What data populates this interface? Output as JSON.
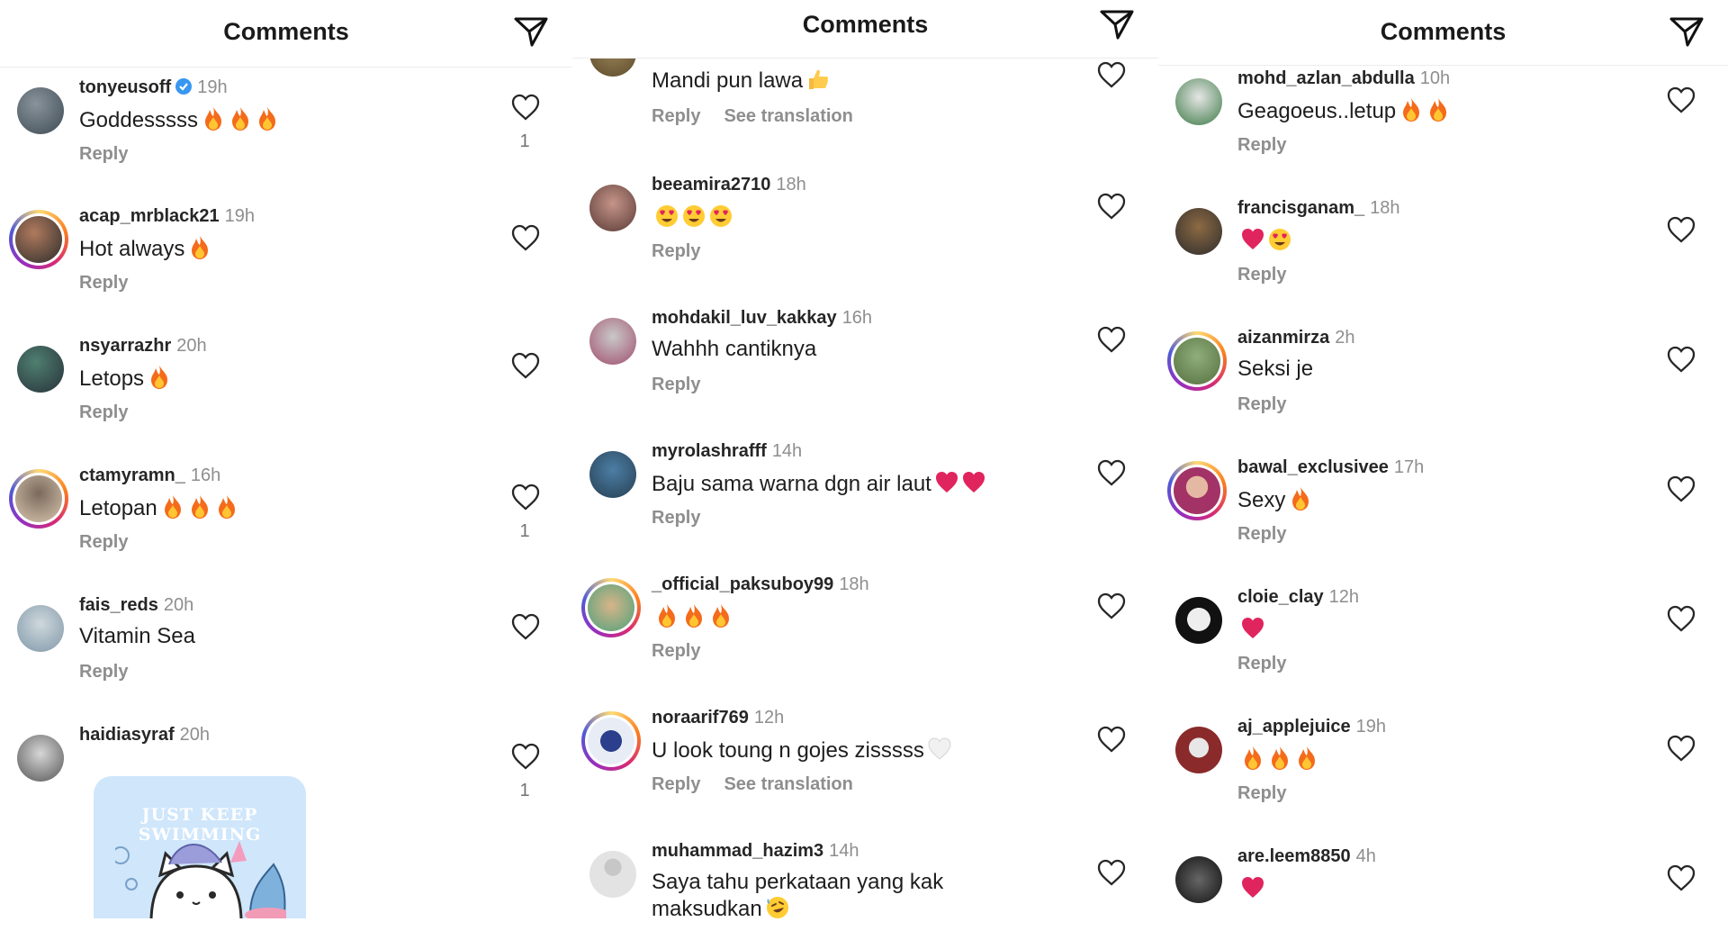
{
  "panels": [
    {
      "title": "Comments",
      "comments": [
        {
          "username": "tonyeusoff",
          "verified": true,
          "time": "19h",
          "text": "Goddesssss",
          "emojis": [
            "fire",
            "fire",
            "fire"
          ],
          "reply": "Reply",
          "likes": "1",
          "avatar_colors": [
            "#3f4b54",
            "#88939b"
          ]
        },
        {
          "username": "acap_mrblack21",
          "time": "19h",
          "text": "Hot always",
          "emojis": [
            "fire"
          ],
          "reply": "Reply",
          "story_ring": true,
          "avatar_colors": [
            "#b07a5d",
            "#2c2c2c"
          ]
        },
        {
          "username": "nsyarrazhr",
          "time": "20h",
          "text": "Letops",
          "emojis": [
            "fire"
          ],
          "reply": "Reply",
          "avatar_colors": [
            "#27313a",
            "#4f7f6f"
          ]
        },
        {
          "username": "ctamyramn_",
          "time": "16h",
          "text": "Letopan",
          "emojis": [
            "fire",
            "fire",
            "fire"
          ],
          "reply": "Reply",
          "likes": "1",
          "story_ring": true,
          "avatar_colors": [
            "#d8c5ae",
            "#7a6a5c"
          ]
        },
        {
          "username": "fais_reds",
          "time": "20h",
          "text": "Vitamin Sea",
          "emojis": [],
          "reply": "Reply",
          "avatar_colors": [
            "#7f97a8",
            "#cfd8dd"
          ]
        },
        {
          "username": "haidiasyraf",
          "time": "20h",
          "text": "",
          "emojis": [],
          "likes": "1",
          "avatar_colors": [
            "#d7d7d7",
            "#555555"
          ],
          "sticker_text": "JUST KEEP SWIMMING"
        }
      ]
    },
    {
      "title": "Comments",
      "comments": [
        {
          "username": "",
          "time": "",
          "text": "Mandi pun lawa",
          "emojis": [
            "thumbs-up"
          ],
          "reply": "Reply",
          "translation": "See translation",
          "avatar_colors": [
            "#9b8558",
            "#5c4a2c"
          ]
        },
        {
          "username": "beeamira2710",
          "time": "18h",
          "text": "",
          "emojis": [
            "heart-eyes",
            "heart-eyes",
            "heart-eyes"
          ],
          "reply": "Reply",
          "avatar_colors": [
            "#5a3b36",
            "#c59489"
          ]
        },
        {
          "username": "mohdakil_luv_kakkay",
          "time": "16h",
          "text": "Wahhh cantiknya",
          "emojis": [],
          "reply": "Reply",
          "avatar_colors": [
            "#c9c9c9",
            "#a14f6d"
          ]
        },
        {
          "username": "myrolashrafff",
          "time": "14h",
          "text": "Baju sama warna dgn air laut",
          "emojis": [
            "red-heart",
            "red-heart"
          ],
          "reply": "Reply",
          "avatar_colors": [
            "#4c7ea5",
            "#263f52"
          ]
        },
        {
          "username": "_official_paksuboy99",
          "time": "18h",
          "text": "",
          "emojis": [
            "fire",
            "fire",
            "fire"
          ],
          "reply": "Reply",
          "story_ring": true,
          "avatar_colors": [
            "#4da27a",
            "#d8b48a"
          ]
        },
        {
          "username": "noraarif769",
          "time": "12h",
          "text": "U look toung n gojes zisssss",
          "emojis": [
            "white-heart"
          ],
          "reply": "Reply",
          "translation": "See translation",
          "story_ring": true,
          "avatar_colors": [
            "#e8edf5",
            "#2b3f8d"
          ]
        },
        {
          "username": "muhammad_hazim3",
          "time": "14h",
          "text": "Saya tahu perkataan yang kak maksudkan",
          "emojis": [
            "rofl"
          ],
          "reply": "",
          "avatar_colors": [
            "#e3e3e3",
            "#c7c7c7"
          ]
        }
      ]
    },
    {
      "title": "Comments",
      "comments": [
        {
          "username": "mohd_azlan_abdulla",
          "time": "10h",
          "text": "Geagoeus..letup",
          "emojis": [
            "fire",
            "fire"
          ],
          "reply": "Reply",
          "avatar_colors": [
            "#3c7a46",
            "#e6e6e6"
          ]
        },
        {
          "username": "francisganam_",
          "time": "18h",
          "text": "",
          "emojis": [
            "red-heart",
            "heart-eyes"
          ],
          "reply": "Reply",
          "avatar_colors": [
            "#8d6a43",
            "#2d2d2d"
          ]
        },
        {
          "username": "aizanmirza",
          "time": "2h",
          "text": "Seksi je",
          "emojis": [],
          "reply": "Reply",
          "story_ring": true,
          "avatar_colors": [
            "#8fae7a",
            "#54703f"
          ]
        },
        {
          "username": "bawal_exclusivee",
          "time": "17h",
          "text": "Sexy",
          "emojis": [
            "fire"
          ],
          "reply": "Reply",
          "story_ring": true,
          "avatar_colors": [
            "#a33366",
            "#e5b8a3"
          ]
        },
        {
          "username": "cloie_clay",
          "time": "12h",
          "text": "",
          "emojis": [
            "red-heart"
          ],
          "reply": "Reply",
          "avatar_colors": [
            "#111111",
            "#eeeeee"
          ]
        },
        {
          "username": "aj_applejuice",
          "time": "19h",
          "text": "",
          "emojis": [
            "fire",
            "fire",
            "fire"
          ],
          "reply": "Reply",
          "avatar_colors": [
            "#8b2a2a",
            "#e7e7e7"
          ]
        },
        {
          "username": "are.leem8850",
          "time": "4h",
          "text": "",
          "emojis": [
            "red-heart"
          ],
          "reply": "",
          "avatar_colors": [
            "#111111",
            "#666666"
          ]
        }
      ]
    }
  ],
  "colors": {
    "text": "#262626",
    "muted": "#8e8e8e",
    "divider": "#ececec",
    "verified": "#3897f0",
    "fire": "#f46b1b",
    "heart": "#e0245e"
  },
  "icons": {
    "header": "send-icon",
    "like": "heart-outline-icon",
    "verified": "verified-badge-icon"
  }
}
